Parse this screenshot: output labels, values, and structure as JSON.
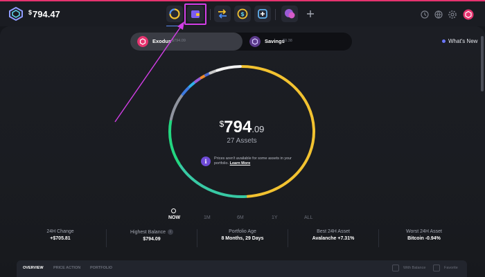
{
  "app": {
    "balance_currency": "$",
    "balance_amount": "794.47"
  },
  "nav": {
    "items": [
      {
        "name": "portfolio",
        "icon": "portfolio-ring-icon",
        "active": true
      },
      {
        "name": "wallet",
        "icon": "wallet-icon",
        "highlighted": true
      },
      {
        "name": "exchange",
        "icon": "exchange-arrows-icon"
      },
      {
        "name": "earn",
        "icon": "dollar-coin-icon"
      },
      {
        "name": "web3",
        "icon": "plus-cube-icon"
      },
      {
        "name": "apps",
        "icon": "apps-bubble-icon"
      },
      {
        "name": "add",
        "icon": "plus-icon"
      }
    ]
  },
  "header_right": {
    "icons": [
      "history-icon",
      "sync-icon",
      "settings-icon",
      "profile-icon"
    ]
  },
  "wallets": {
    "exodus": {
      "label": "Exodus",
      "value": "$794.09"
    },
    "savings": {
      "label": "Savings",
      "value": "$0.38"
    }
  },
  "whats_new": "What's New",
  "portfolio": {
    "currency": "$",
    "integer": "794",
    "decimal": ".09",
    "assets": "27 Assets",
    "notice_text": "Prices aren't available for some assets in your portfolio.",
    "notice_link": "Learn More"
  },
  "ranges": [
    "NOW",
    "1M",
    "6M",
    "1Y",
    "ALL"
  ],
  "active_range": "NOW",
  "stats": [
    {
      "label": "24H Change",
      "value": "+$705.81"
    },
    {
      "label": "Highest Balance",
      "value": "$794.09"
    },
    {
      "label": "Portfolio Age",
      "value": "8 Months, 29 Days"
    },
    {
      "label": "Best 24H Asset",
      "value": "Avalanche +7.31%"
    },
    {
      "label": "Worst 24H Asset",
      "value": "Bitcoin -0.94%"
    }
  ],
  "tabs": [
    "OVERVIEW",
    "PRICE ACTION",
    "PORTFOLIO"
  ],
  "filters": {
    "with_balance": "With Balance",
    "favorite": "Favorite"
  },
  "colors": {
    "accent_pink": "#e6336f",
    "highlight_magenta": "#d23ee6",
    "ring_yellow": "#f2c230",
    "ring_teal": "#38c9a4",
    "ring_green": "#23d680",
    "ring_white": "#f2f2f2",
    "ring_gray": "#8f939e"
  },
  "donut_segments": [
    {
      "from": -90,
      "to": 87,
      "color": "#f2c230"
    },
    {
      "from": 87,
      "to": 150,
      "color": "#38c9a4"
    },
    {
      "from": 150,
      "to": 191,
      "color": "#23d680"
    },
    {
      "from": 191,
      "to": 215,
      "color": "#8f939e"
    },
    {
      "from": 215,
      "to": 224,
      "color": "#3e7be0"
    },
    {
      "from": 224,
      "to": 230,
      "color": "#2fb0e8"
    },
    {
      "from": 230,
      "to": 236,
      "color": "#9a5bd6"
    },
    {
      "from": 236,
      "to": 240,
      "color": "#f08a2c"
    },
    {
      "from": 240,
      "to": 244,
      "color": "#4a6ad0"
    },
    {
      "from": 244,
      "to": 250,
      "color": "#c9c9c9"
    },
    {
      "from": 250,
      "to": 270,
      "color": "#f2f2f2"
    }
  ]
}
